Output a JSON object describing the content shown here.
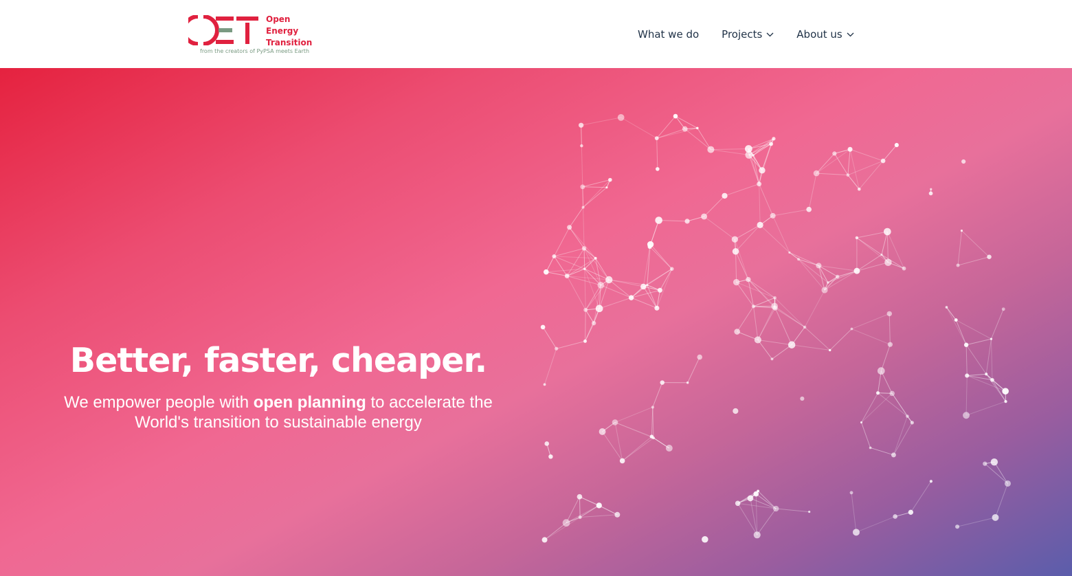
{
  "brand": {
    "mark": "OET",
    "name_lines": [
      "Open",
      "Energy",
      "Transition"
    ],
    "tagline": "from the creators of PyPSA meets Earth",
    "colors": {
      "red": "#e0213f",
      "green": "#7a9a82"
    }
  },
  "nav": {
    "items": [
      {
        "label": "What we do",
        "has_dropdown": false
      },
      {
        "label": "Projects",
        "has_dropdown": true,
        "icon": "chevron-down-icon"
      },
      {
        "label": "About us",
        "has_dropdown": true,
        "icon": "chevron-down-icon"
      }
    ],
    "text_color": "#1f3146"
  },
  "hero": {
    "title": "Better, faster, cheaper.",
    "subtitle": {
      "pre": "We empower people with ",
      "bold": "open planning",
      "post": " to accelerate the World's transition to sustainable energy"
    },
    "gradient_colors": [
      "#e5223f",
      "#f06892",
      "#5b5dab"
    ]
  }
}
